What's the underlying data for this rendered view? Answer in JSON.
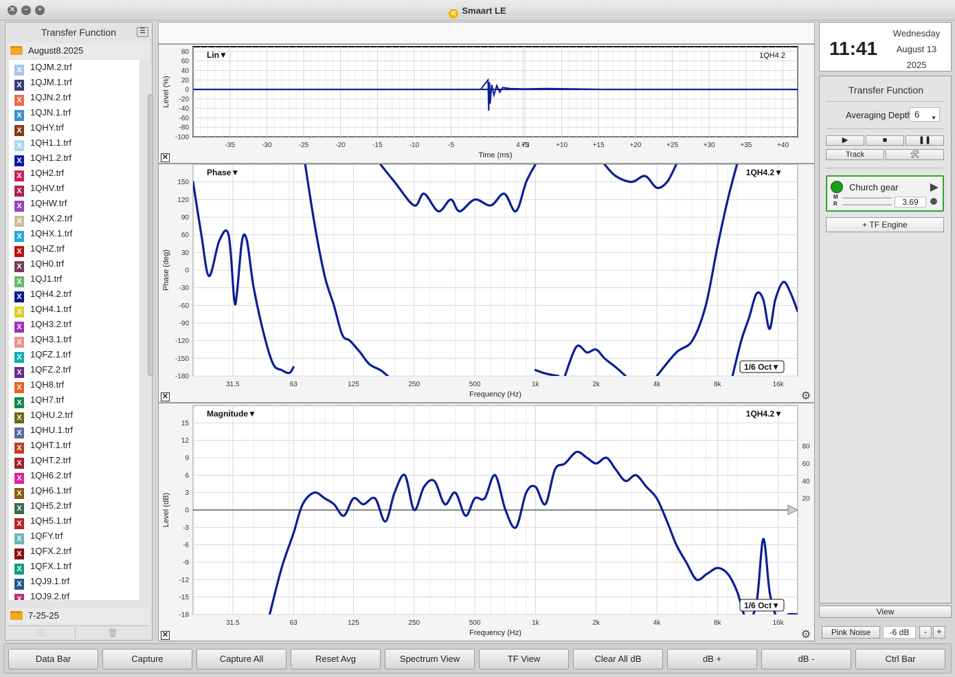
{
  "window": {
    "title": "Smaart LE",
    "logo_glyph": "iE"
  },
  "left_panel": {
    "title": "Transfer Function",
    "folder_top": "August8.2025",
    "folder_bottom": "7-25-25",
    "files": [
      {
        "name": "1QJM.2.trf",
        "color": "#a9c6ea"
      },
      {
        "name": "1QJM.1.trf",
        "color": "#3a3f7a"
      },
      {
        "name": "1QJN.2.trf",
        "color": "#f06a4a"
      },
      {
        "name": "1QJN.1.trf",
        "color": "#3a8fd0"
      },
      {
        "name": "1QHY.trf",
        "color": "#8a3a1a"
      },
      {
        "name": "1QH1.1.trf",
        "color": "#a8d8ea"
      },
      {
        "name": "1QH1.2.trf",
        "color": "#0a1aa8"
      },
      {
        "name": "1QH2.trf",
        "color": "#d22050"
      },
      {
        "name": "1QHV.trf",
        "color": "#b02050"
      },
      {
        "name": "1QHW.trf",
        "color": "#9a40c0"
      },
      {
        "name": "1QHX.2.trf",
        "color": "#c8c090"
      },
      {
        "name": "1QHX.1.trf",
        "color": "#20a8e0"
      },
      {
        "name": "1QHZ.trf",
        "color": "#c01010"
      },
      {
        "name": "1QH0.trf",
        "color": "#7a3a5a"
      },
      {
        "name": "1QJ1.trf",
        "color": "#6ab86a"
      },
      {
        "name": "1QH4.2.trf",
        "color": "#0a1a90"
      },
      {
        "name": "1QH4.1.trf",
        "color": "#d8d020"
      },
      {
        "name": "1QH3.2.trf",
        "color": "#a030c0"
      },
      {
        "name": "1QH3.1.trf",
        "color": "#f09090"
      },
      {
        "name": "1QFZ.1.trf",
        "color": "#10b0b0"
      },
      {
        "name": "1QFZ.2.trf",
        "color": "#6a2a8a"
      },
      {
        "name": "1QH8.trf",
        "color": "#f06020"
      },
      {
        "name": "1QH7.trf",
        "color": "#108a50"
      },
      {
        "name": "1QHU.2.trf",
        "color": "#6a6a10"
      },
      {
        "name": "1QHU.1.trf",
        "color": "#5a6aa0"
      },
      {
        "name": "1QHT.1.trf",
        "color": "#c04020"
      },
      {
        "name": "1QHT.2.trf",
        "color": "#a02030"
      },
      {
        "name": "1QH6.2.trf",
        "color": "#e020a0"
      },
      {
        "name": "1QH6.1.trf",
        "color": "#8a5a10"
      },
      {
        "name": "1QH5.2.trf",
        "color": "#3a6a4a"
      },
      {
        "name": "1QH5.1.trf",
        "color": "#c02020"
      },
      {
        "name": "1QFY.trf",
        "color": "#6ab8b0"
      },
      {
        "name": "1QFX.2.trf",
        "color": "#8a1010"
      },
      {
        "name": "1QFX.1.trf",
        "color": "#10a080"
      },
      {
        "name": "1QJ9.1.trf",
        "color": "#205a90"
      },
      {
        "name": "1QJ9.2.trf",
        "color": "#b03070"
      }
    ]
  },
  "clock": {
    "time": "11:41",
    "day": "Wednesday",
    "date": "August 13",
    "year": "2025"
  },
  "right_panel": {
    "title": "Transfer Function",
    "averaging_label": "Averaging Depth:",
    "averaging_value": "6",
    "play_glyph": "▶",
    "stop_glyph": "■",
    "pause_glyph": "❚❚",
    "track_label": "Track",
    "tools_glyph": "🛠",
    "engine_name": "Church gear",
    "engine_play_glyph": "▶",
    "m_label": "M",
    "r_label": "R",
    "engine_value": "3.69",
    "tf_engine_label": "+ TF Engine",
    "view_label": "View",
    "pink_noise_label": "Pink Noise",
    "pink_noise_value": "-6 dB",
    "minus_label": "-",
    "plus_label": "+"
  },
  "icons": {
    "close": "✕",
    "gear": "⚙",
    "info": "ⓘ",
    "trash": "🗑",
    "menu": "☰"
  },
  "bottom_bar": {
    "buttons": [
      "Data Bar",
      "Capture",
      "Capture All",
      "Reset Avg",
      "Spectrum View",
      "TF View",
      "Clear All dB",
      "dB +",
      "dB -",
      "Ctrl Bar"
    ]
  },
  "trace_color": "#0b1e96",
  "chart_data": [
    {
      "type": "line",
      "name_label": "Lin▼",
      "trace_label": "1QH4.2",
      "xlabel": "Time (ms)",
      "ylabel": "Level (%)",
      "xlim": [
        -40,
        42
      ],
      "ylim": [
        -100,
        90
      ],
      "x_ticks": [
        -35,
        -30,
        -25,
        -20,
        -15,
        -10,
        -5,
        4.73,
        5,
        10,
        15,
        20,
        25,
        30,
        35,
        40
      ],
      "x_tick_labels": [
        "-35",
        "-30",
        "-25",
        "-20",
        "-15",
        "-10",
        "-5",
        "4.73",
        "+5",
        "+10",
        "+15",
        "+20",
        "+25",
        "+30",
        "+35",
        "+40"
      ],
      "y_ticks": [
        80,
        60,
        40,
        20,
        0,
        -20,
        -40,
        -60,
        -80,
        -100
      ],
      "impulse": {
        "x": [
          -40,
          -1,
          0,
          0.1,
          0.2,
          0.3,
          0.5,
          0.8,
          1.2,
          1.6,
          2,
          3,
          5,
          8,
          12,
          16,
          20,
          42
        ],
        "y": [
          0,
          0,
          20,
          -45,
          15,
          -30,
          10,
          -12,
          8,
          -6,
          4,
          2,
          1,
          2,
          1,
          0,
          0,
          0
        ]
      }
    },
    {
      "type": "line",
      "name_label": "Phase▼",
      "trace_label": "1QH4.2▼",
      "smoothing_label": "1/6 Oct▼",
      "xlabel": "Frequency (Hz)",
      "ylabel": "Phase (deg)",
      "x_scale": "log",
      "xlim": [
        20,
        20000
      ],
      "ylim": [
        -180,
        180
      ],
      "x_ticks": [
        31.5,
        63,
        125,
        250,
        500,
        1000,
        2000,
        4000,
        8000,
        16000
      ],
      "x_tick_labels": [
        "31.5",
        "63",
        "125",
        "250",
        "500",
        "1k",
        "2k",
        "4k",
        "8k",
        "16k"
      ],
      "y_ticks": [
        150,
        120,
        90,
        60,
        30,
        0,
        -30,
        -60,
        -90,
        -120,
        -150,
        -180
      ],
      "segments": [
        {
          "x": [
            20,
            22,
            24,
            27,
            30,
            32,
            33,
            35,
            37,
            40,
            45,
            50,
            55,
            60,
            63
          ],
          "y": [
            150,
            60,
            -10,
            50,
            60,
            -50,
            -40,
            50,
            50,
            -30,
            -110,
            -160,
            -170,
            -175,
            -165
          ]
        },
        {
          "x": [
            72,
            80,
            90,
            100,
            110,
            120,
            135,
            150,
            170,
            185
          ],
          "y": [
            180,
            80,
            -10,
            -60,
            -110,
            -120,
            -140,
            -160,
            -170,
            -180
          ]
        },
        {
          "x": [
            170,
            200,
            250,
            280,
            330,
            380,
            420,
            500,
            600,
            700,
            800,
            900,
            1000
          ],
          "y": [
            180,
            150,
            110,
            130,
            100,
            120,
            100,
            120,
            110,
            130,
            100,
            150,
            180
          ]
        },
        {
          "x": [
            1000,
            1100,
            1200,
            1300
          ],
          "y": [
            -170,
            -175,
            -178,
            -180
          ]
        },
        {
          "x": [
            1400,
            1600,
            1800,
            2000,
            2200,
            2500,
            2800
          ],
          "y": [
            -180,
            -130,
            -140,
            -135,
            -150,
            -165,
            -180
          ]
        },
        {
          "x": [
            2200,
            2500,
            3000,
            3500,
            4000,
            4500,
            5000
          ],
          "y": [
            180,
            160,
            150,
            160,
            140,
            150,
            180
          ]
        },
        {
          "x": [
            4000,
            5000,
            6000,
            7000,
            8000,
            9000,
            10000
          ],
          "y": [
            -180,
            -140,
            -120,
            -60,
            40,
            120,
            180
          ]
        },
        {
          "x": [
            9500,
            10500,
            11500,
            12500,
            13500,
            14500,
            15500,
            17000,
            18500,
            20000
          ],
          "y": [
            -180,
            -120,
            -80,
            -40,
            -50,
            -100,
            -50,
            -20,
            -40,
            -70
          ]
        }
      ]
    },
    {
      "type": "line",
      "name_label": "Magnitude▼",
      "trace_label": "1QH4.2▼",
      "smoothing_label": "1/6 Oct▼",
      "xlabel": "Frequency (Hz)",
      "ylabel": "Level (dB)",
      "x_scale": "log",
      "xlim": [
        20,
        20000
      ],
      "ylim": [
        -18,
        18
      ],
      "x_ticks": [
        31.5,
        63,
        125,
        250,
        500,
        1000,
        2000,
        4000,
        8000,
        16000
      ],
      "x_tick_labels": [
        "31.5",
        "63",
        "125",
        "250",
        "500",
        "1k",
        "2k",
        "4k",
        "8k",
        "16k"
      ],
      "y_ticks": [
        15,
        12,
        9,
        6,
        3,
        0,
        -3,
        -6,
        -9,
        -12,
        -15,
        -18
      ],
      "y2_ticks": [
        80,
        60,
        40,
        20
      ],
      "curve": {
        "x": [
          48,
          55,
          63,
          70,
          80,
          90,
          100,
          112,
          125,
          140,
          160,
          180,
          200,
          225,
          250,
          280,
          315,
          355,
          400,
          450,
          500,
          560,
          630,
          710,
          800,
          900,
          1000,
          1120,
          1250,
          1400,
          1600,
          1800,
          2000,
          2250,
          2500,
          2800,
          3150,
          3550,
          4000,
          4500,
          5000,
          5600,
          6300,
          7100,
          8000,
          9000,
          10000,
          11200,
          12500,
          13500,
          14500,
          15500,
          16500,
          18000,
          20000
        ],
        "y": [
          -18,
          -10,
          -4,
          1,
          3,
          2,
          1,
          -1,
          2,
          1,
          2,
          -2,
          3,
          6,
          0,
          4,
          5,
          1,
          3,
          -1,
          2,
          2,
          6,
          0,
          -3,
          3,
          4,
          1,
          7,
          8,
          10,
          9,
          8,
          9,
          7,
          5,
          6,
          4,
          2,
          -2,
          -6,
          -9,
          -12,
          -11,
          -10,
          -11,
          -14,
          -19,
          -16,
          -5,
          -14,
          -18,
          -19,
          -18,
          -18
        ]
      }
    }
  ]
}
